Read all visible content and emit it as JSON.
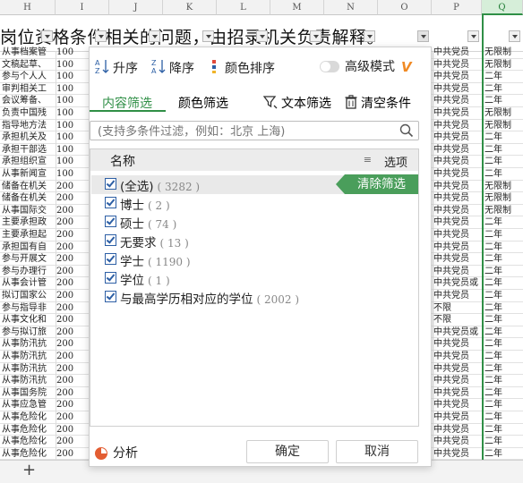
{
  "sheet": {
    "columns": [
      "H",
      "I",
      "J",
      "K",
      "L",
      "M",
      "N",
      "O",
      "P",
      "Q"
    ],
    "title_text": "岗位资格条件相关的问题，由招录机关负责解释。",
    "rows": [
      [
        "从事档案管",
        "100",
        "中共党员",
        "无限制"
      ],
      [
        "文稿起草、",
        "100",
        "中共党员",
        "无限制"
      ],
      [
        "参与个人人",
        "100",
        "中共党员",
        "二年"
      ],
      [
        "审判相关工",
        "100",
        "中共党员",
        "二年"
      ],
      [
        "会议筹备、",
        "100",
        "中共党员",
        "二年"
      ],
      [
        "负责中国残",
        "100",
        "中共党员",
        "无限制"
      ],
      [
        "指导地方法",
        "100",
        "中共党员",
        "无限制"
      ],
      [
        "承担机关及",
        "100",
        "中共党员",
        "二年"
      ],
      [
        "承担干部选",
        "100",
        "中共党员",
        "二年"
      ],
      [
        "承担组织宣",
        "100",
        "中共党员",
        "二年"
      ],
      [
        "从事新闻宣",
        "100",
        "中共党员",
        "二年"
      ],
      [
        "储备在机关",
        "200",
        "中共党员",
        "无限制"
      ],
      [
        "储备在机关",
        "200",
        "中共党员",
        "无限制"
      ],
      [
        "从事国际交",
        "200",
        "中共党员",
        "无限制"
      ],
      [
        "主要承担政",
        "200",
        "中共党员",
        "二年"
      ],
      [
        "主要承担起",
        "200",
        "中共党员",
        "二年"
      ],
      [
        "承担国有自",
        "200",
        "中共党员",
        "二年"
      ],
      [
        "参与开展文",
        "200",
        "中共党员",
        "二年"
      ],
      [
        "参与办理行",
        "200",
        "中共党员",
        "二年"
      ],
      [
        "从事会计管",
        "200",
        "中共党员或",
        "二年"
      ],
      [
        "拟订国家公",
        "200",
        "中共党员",
        "二年"
      ],
      [
        "参与指导非",
        "200",
        "不限",
        "二年"
      ],
      [
        "从事文化和",
        "200",
        "不限",
        "二年"
      ],
      [
        "参与拟订旅",
        "200",
        "中共党员或",
        "二年"
      ],
      [
        "从事防汛抗",
        "200",
        "中共党员",
        "二年"
      ],
      [
        "从事防汛抗",
        "200",
        "中共党员",
        "二年"
      ],
      [
        "从事防汛抗",
        "200",
        "中共党员",
        "二年"
      ],
      [
        "从事防汛抗",
        "200",
        "中共党员",
        "二年"
      ],
      [
        "从事国务院",
        "200",
        "中共党员",
        "二年"
      ],
      [
        "从事应急管",
        "200",
        "中共党员",
        "二年"
      ],
      [
        "从事危险化",
        "200",
        "中共党员",
        "二年"
      ],
      [
        "从事危险化",
        "200",
        "中共党员",
        "二年"
      ],
      [
        "从事危险化",
        "200",
        "中共党员",
        "二年"
      ],
      [
        "从事危险化",
        "200",
        "中共党员",
        "二年"
      ]
    ]
  },
  "panel": {
    "toolbar": {
      "sort_asc": "升序",
      "sort_desc": "降序",
      "color_sort": "颜色排序",
      "advanced_mode": "高级模式",
      "vip_badge": "V"
    },
    "tabs": {
      "content_filter": "内容筛选",
      "color_filter": "颜色筛选",
      "text_filter": "文本筛选",
      "clear_conditions": "清空条件"
    },
    "search_placeholder": "(支持多条件过滤，例如：北京 上海)",
    "list_header": {
      "name": "名称",
      "options": "选项"
    },
    "clear_filter_button": "清除筛选",
    "items": [
      {
        "label": "(全选)",
        "count": "( 3282 )"
      },
      {
        "label": "博士",
        "count": "( 2 )"
      },
      {
        "label": "硕士",
        "count": "( 74 )"
      },
      {
        "label": "无要求",
        "count": "( 13 )"
      },
      {
        "label": "学士",
        "count": "( 1190 )"
      },
      {
        "label": "学位",
        "count": "( 1 )"
      },
      {
        "label": "与最高学历相对应的学位",
        "count": "( 2002 )"
      }
    ],
    "footer": {
      "analyze": "分析",
      "ok": "确定",
      "cancel": "取消"
    }
  },
  "colors": {
    "accent_green": "#2f8f46",
    "clear_button_green": "#4a9e5b",
    "vip_orange": "#f08a24",
    "checkbox_blue": "#2d5fa5"
  }
}
